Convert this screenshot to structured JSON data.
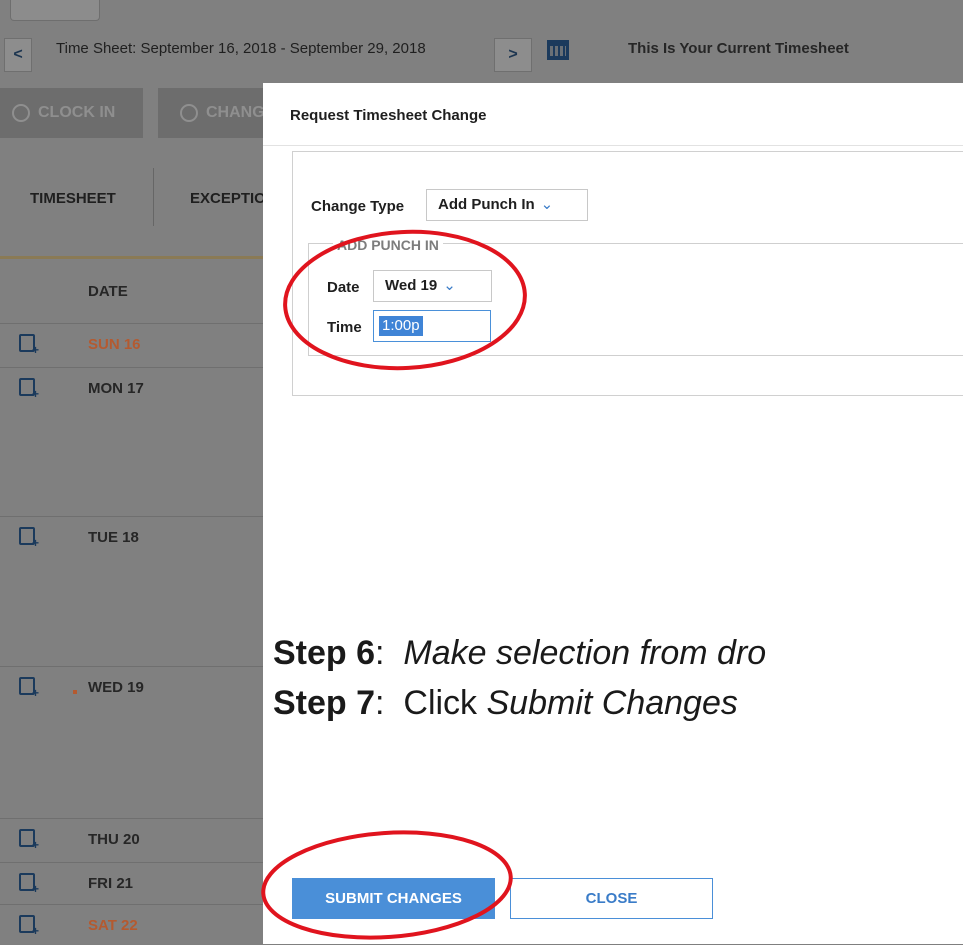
{
  "background": {
    "nav": {
      "prev_glyph": "<",
      "next_glyph": ">",
      "period_text": "Time Sheet: September 16, 2018 - September 29, 2018",
      "current_text": "This Is Your Current Timesheet"
    },
    "buttons": {
      "clock_in": "CLOCK IN",
      "change": "CHANG"
    },
    "tabs": {
      "timesheet": "TIMESHEET",
      "exceptions": "EXCEPTIO"
    },
    "date_header": "DATE",
    "rows": [
      {
        "label": "SUN 16",
        "weekend": true
      },
      {
        "label": "MON 17",
        "weekend": false
      },
      {
        "label": "TUE 18",
        "weekend": false
      },
      {
        "label": "WED 19",
        "weekend": false
      },
      {
        "label": "THU 20",
        "weekend": false
      },
      {
        "label": "FRI 21",
        "weekend": false
      },
      {
        "label": "SAT 22",
        "weekend": true
      }
    ]
  },
  "modal": {
    "title": "Request Timesheet Change",
    "change_type_label": "Change Type",
    "change_type_value": "Add Punch In",
    "section_legend": "ADD PUNCH IN",
    "date_label": "Date",
    "date_value": "Wed 19",
    "time_label": "Time",
    "time_value": "1:00p",
    "submit_label": "SUBMIT CHANGES",
    "close_label": "CLOSE"
  },
  "instructions": {
    "step6_label": "Step 6",
    "step6_text": "Make selection from dro",
    "step7_label": "Step 7",
    "step7_prefix": "Click ",
    "step7_text": "Submit Changes"
  },
  "colors": {
    "accent": "#4a8fd8",
    "weekend": "#b45a30",
    "annotation": "#e0141e",
    "navy": "#1b3a5c"
  },
  "icons": {
    "chevron": "chevron-down-icon",
    "calendar": "calendar-icon",
    "clock": "clock-icon",
    "history": "history-icon",
    "add_note": "add-note-icon"
  }
}
